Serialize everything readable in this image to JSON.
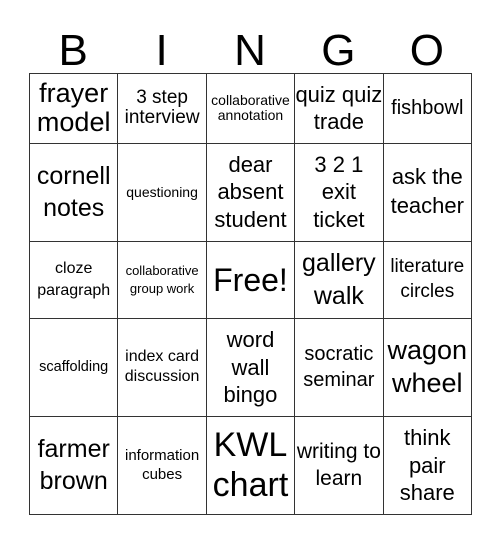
{
  "header": [
    "B",
    "I",
    "N",
    "G",
    "O"
  ],
  "cells": [
    [
      "frayer model",
      "3 step interview",
      "collaborative annotation",
      "quiz quiz trade",
      "fishbowl"
    ],
    [
      "cornell notes",
      "questioning",
      "dear absent student",
      "3 2 1 exit ticket",
      "ask the teacher"
    ],
    [
      "cloze paragraph",
      "collaborative group work",
      "Free!",
      "gallery walk",
      "literature circles"
    ],
    [
      "scaffolding",
      "index card discussion",
      "word wall bingo",
      "socratic seminar",
      "wagon wheel"
    ],
    [
      "farmer brown",
      "information cubes",
      "KWL chart",
      "writing to learn",
      "think pair share"
    ]
  ]
}
